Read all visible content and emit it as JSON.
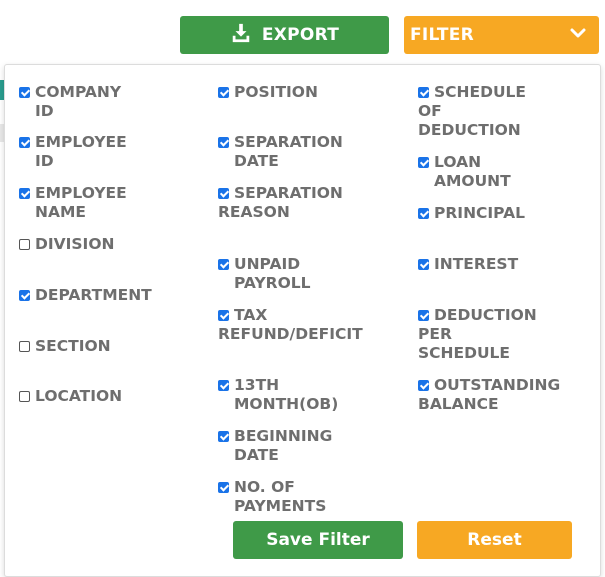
{
  "toolbar": {
    "export_label": "EXPORT",
    "filter_label": "FILTER"
  },
  "columns_panel": {
    "column_1": [
      {
        "label": "COMPANY ID",
        "checked": true
      },
      {
        "label": "EMPLOYEE ID",
        "checked": true
      },
      {
        "label": "EMPLOYEE NAME",
        "checked": true
      },
      {
        "label": "DIVISION",
        "checked": false
      },
      {
        "label": "DEPARTMENT",
        "checked": true
      },
      {
        "label": "SECTION",
        "checked": false
      },
      {
        "label": "LOCATION",
        "checked": false
      }
    ],
    "column_2": [
      {
        "label": "POSITION",
        "checked": true
      },
      {
        "label": "SEPARATION DATE",
        "checked": true
      },
      {
        "label": "SEPARATION\nREASON",
        "checked": true
      },
      {
        "label": "UNPAID PAYROLL",
        "checked": true
      },
      {
        "label": "TAX\nREFUND/DEFICIT",
        "checked": true
      },
      {
        "label": "13TH MONTH(OB)",
        "checked": true
      },
      {
        "label": "BEGINNING DATE",
        "checked": true
      },
      {
        "label": "NO. OF PAYMENTS",
        "checked": true
      }
    ],
    "column_3": [
      {
        "label": "SCHEDULE OF\nDEDUCTION",
        "checked": true
      },
      {
        "label": "LOAN AMOUNT",
        "checked": true
      },
      {
        "label": "PRINCIPAL",
        "checked": true
      },
      {
        "label": "INTEREST",
        "checked": true
      },
      {
        "label": "DEDUCTION PER\nSCHEDULE",
        "checked": true
      },
      {
        "label": "OUTSTANDING\nBALANCE",
        "checked": true
      }
    ]
  },
  "actions": {
    "save_label": "Save Filter",
    "reset_label": "Reset"
  },
  "colors": {
    "green": "#3f9a48",
    "orange": "#f7a823",
    "checkbox_blue": "#1a73e8",
    "label_gray": "#6e6e6e"
  },
  "icons": {
    "export": "download-icon",
    "filter": "chevron-down-icon"
  }
}
